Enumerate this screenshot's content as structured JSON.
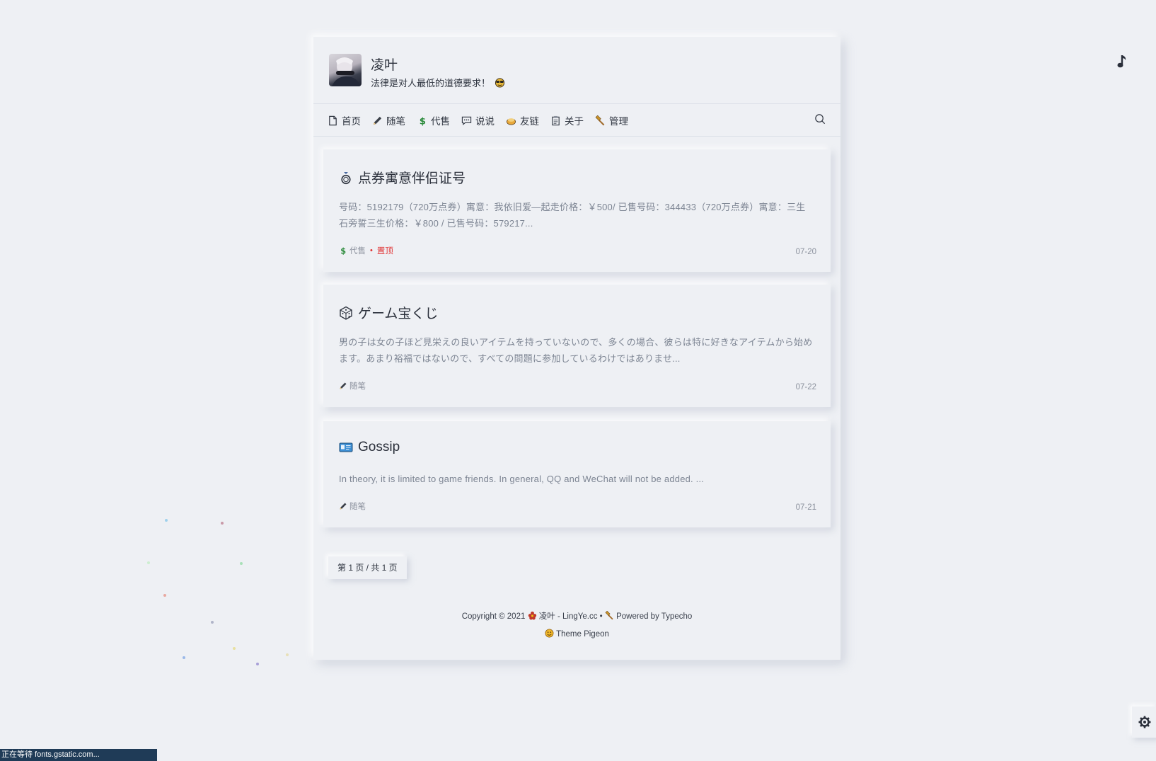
{
  "site": {
    "title": "凌叶",
    "description": "法律是对人最低的道德要求！"
  },
  "nav": {
    "items": [
      {
        "label": "首页",
        "icon": "home-doc-icon"
      },
      {
        "label": "随笔",
        "icon": "pencil-icon"
      },
      {
        "label": "代售",
        "icon": "dollar-icon"
      },
      {
        "label": "说说",
        "icon": "speech-bubble-icon"
      },
      {
        "label": "友链",
        "icon": "pudding-icon"
      },
      {
        "label": "关于",
        "icon": "clipboard-icon"
      },
      {
        "label": "管理",
        "icon": "hammer-icon"
      }
    ],
    "search_icon": "search-icon"
  },
  "posts": [
    {
      "title": "点券寓意伴侣证号",
      "icon": "ring-icon",
      "excerpt": "号码：5192179（720万点券）寓意：我依旧爱—起走价格：￥500/ 已售号码：344433（720万点券）寓意：三生石旁誓三生价格：￥800 / 已售号码：579217...",
      "category": "代售",
      "category_icon": "dollar-icon",
      "sticky": "置顶",
      "date": "07-20"
    },
    {
      "title": "ゲーム宝くじ",
      "icon": "dice-icon",
      "excerpt": "男の子は女の子ほど見栄えの良いアイテムを持っていないので、多くの場合、彼らは特に好きなアイテムから始めます。あまり裕福ではないので、すべての問題に参加しているわけではありませ...",
      "category": "随笔",
      "category_icon": "pencil-icon",
      "date": "07-22"
    },
    {
      "title": "Gossip",
      "icon": "id-card-icon",
      "excerpt": "In theory, it is limited to game friends. In general, QQ and WeChat will not be added. ...",
      "category": "随笔",
      "category_icon": "pencil-icon",
      "date": "07-21"
    }
  ],
  "pagination": {
    "label": "第 1 页 / 共 1 页"
  },
  "footer": {
    "copyright": "Copyright © 2021",
    "site_link": "凌叶 - LingYe.cc",
    "separator": "•",
    "powered": "Powered by Typecho",
    "theme": "Theme Pigeon"
  },
  "status_bar": {
    "text": "正在等待 fonts.gstatic.com..."
  },
  "colors": {
    "background": "#eef0f4",
    "sticky": "#e03030",
    "dollar": "#2a8a3a",
    "status_bar": "#1f3b57"
  }
}
